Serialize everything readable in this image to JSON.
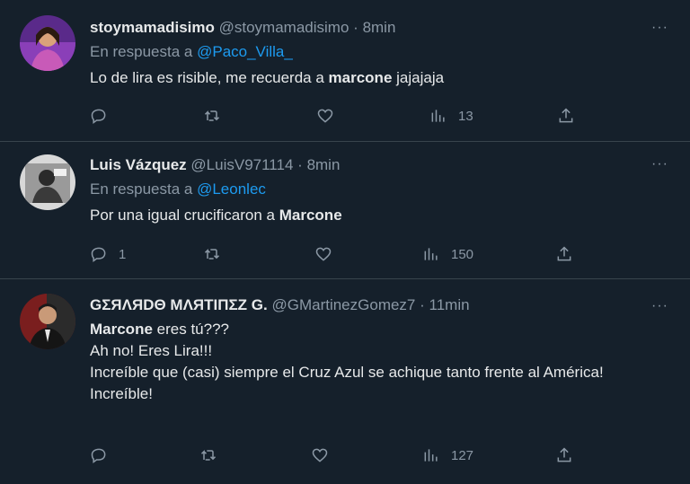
{
  "tweets": [
    {
      "name": "stoymamadisimo",
      "handle": "@stoymamadisimo",
      "sep": "·",
      "time": "8min",
      "reply_prefix": "En respuesta a",
      "reply_to": "@Paco_Villa_",
      "text_parts": [
        "Lo de lira es risible, me recuerda a ",
        "marcone",
        " jajajaja"
      ],
      "counts": {
        "reply": "",
        "retweet": "",
        "like": "",
        "views": "13"
      }
    },
    {
      "name": "Luis Vázquez",
      "handle": "@LuisV971114",
      "sep": "·",
      "time": "8min",
      "reply_prefix": "En respuesta a",
      "reply_to": "@Leonlec",
      "text_parts": [
        "Por una igual crucificaron a ",
        "Marcone"
      ],
      "counts": {
        "reply": "1",
        "retweet": "",
        "like": "",
        "views": "150"
      }
    },
    {
      "name": "GΣЯΛЯDΘ MΛЯTIПΣZ G.",
      "handle": "@GMartinezGomez7",
      "sep": "·",
      "time": "11min",
      "lines": {
        "l1_bold": "Marcone",
        "l1_rest": " eres tú???",
        "l2": "Ah no! Eres Lira!!!",
        "l3": "Increíble que (casi) siempre el Cruz Azul se achique tanto frente al América!",
        "l4": "Increíble!"
      },
      "counts": {
        "reply": "",
        "retweet": "",
        "like": "",
        "views": "127"
      }
    }
  ],
  "colors": {
    "background": "#15202b",
    "text": "#e7e9ea",
    "muted": "#8b98a5",
    "link": "#1d9bf0",
    "divider": "#38444d"
  },
  "icons": [
    "reply-icon",
    "retweet-icon",
    "like-icon",
    "views-icon",
    "share-icon",
    "more-icon"
  ],
  "more_glyph": "···"
}
